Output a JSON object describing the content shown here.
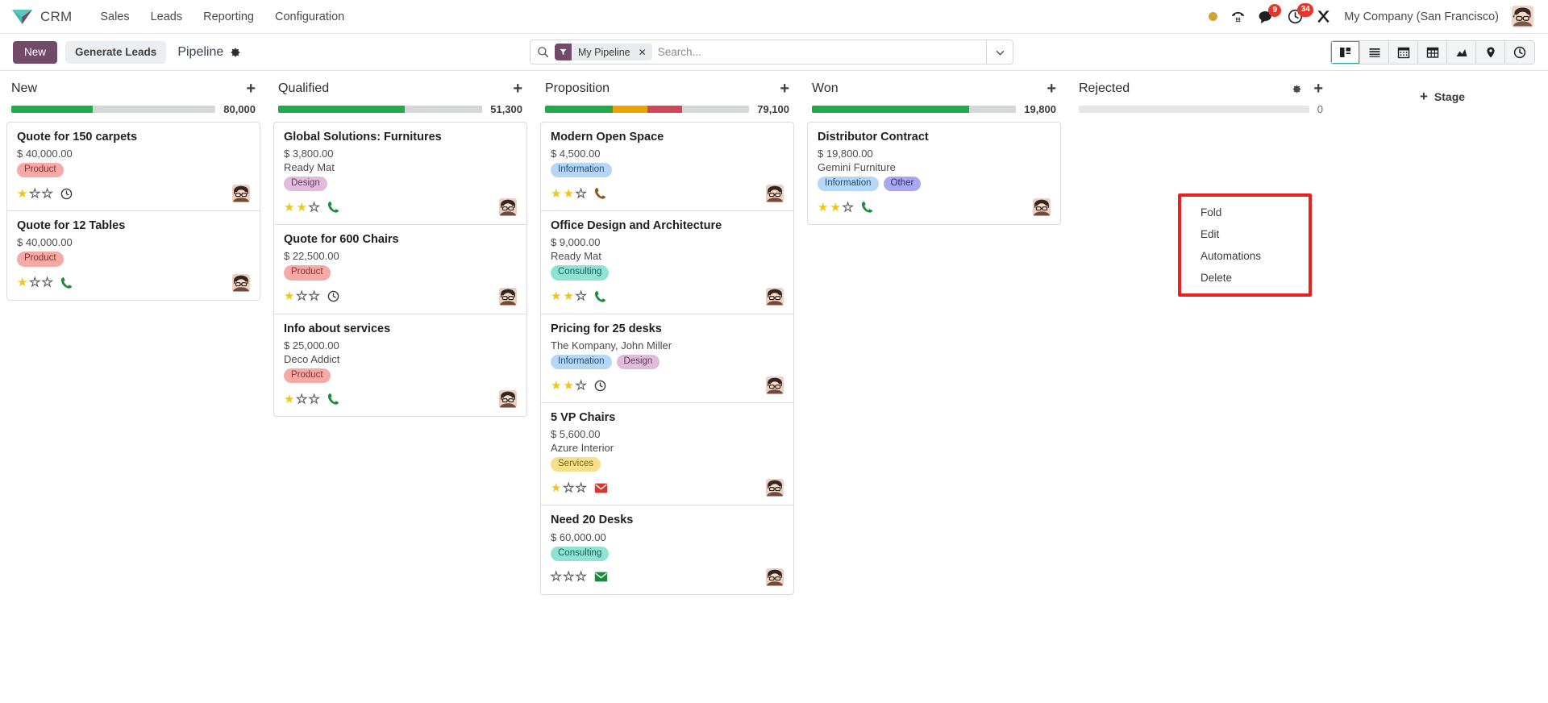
{
  "navbar": {
    "brand": "CRM",
    "menu": [
      "Sales",
      "Leads",
      "Reporting",
      "Configuration"
    ],
    "chat_badge": "9",
    "activity_badge": "34",
    "company": "My Company (San Francisco)"
  },
  "control_panel": {
    "new_label": "New",
    "generate_leads_label": "Generate Leads",
    "breadcrumb": "Pipeline",
    "search": {
      "facet_label": "My Pipeline",
      "placeholder": "Search..."
    },
    "views": [
      "kanban",
      "list",
      "calendar",
      "pivot",
      "graph",
      "map",
      "activity"
    ],
    "active_view": "kanban"
  },
  "add_stage_label": "Stage",
  "column_menu": {
    "items": [
      "Fold",
      "Edit",
      "Automations",
      "Delete"
    ],
    "open_for_column": "Rejected",
    "highlight_color": "#e8231f"
  },
  "tag_colors": {
    "Product": {
      "bg": "#f6aaa7",
      "fg": "#8b2f2b"
    },
    "Design": {
      "bg": "#e0bcdb",
      "fg": "#6d3566"
    },
    "Information": {
      "bg": "#b5d7f5",
      "fg": "#1f4e78"
    },
    "Consulting": {
      "bg": "#8fe3d4",
      "fg": "#155e51"
    },
    "Services": {
      "bg": "#f7e08a",
      "fg": "#7a6212"
    },
    "Other": {
      "bg": "#a9a8ef",
      "fg": "#2f2d7a"
    }
  },
  "columns": [
    {
      "name": "New",
      "total": "80,000",
      "progress": [
        {
          "color": "#23a94a",
          "pct": 40
        },
        {
          "color": "#d5d6d8",
          "pct": 60
        }
      ],
      "has_gear": false,
      "cards": [
        {
          "title": "Quote for 150 carpets",
          "amount": "$ 40,000.00",
          "partner": "",
          "tags": [
            "Product"
          ],
          "stars": 1,
          "activity": "clock-grey"
        },
        {
          "title": "Quote for 12 Tables",
          "amount": "$ 40,000.00",
          "partner": "",
          "tags": [
            "Product"
          ],
          "stars": 1,
          "activity": "phone-green"
        }
      ]
    },
    {
      "name": "Qualified",
      "total": "51,300",
      "progress": [
        {
          "color": "#23a94a",
          "pct": 62
        },
        {
          "color": "#d5d6d8",
          "pct": 38
        }
      ],
      "has_gear": false,
      "cards": [
        {
          "title": "Global Solutions: Furnitures",
          "amount": "$ 3,800.00",
          "partner": "Ready Mat",
          "tags": [
            "Design"
          ],
          "stars": 2,
          "activity": "phone-green"
        },
        {
          "title": "Quote for 600 Chairs",
          "amount": "$ 22,500.00",
          "partner": "",
          "tags": [
            "Product"
          ],
          "stars": 1,
          "activity": "clock-grey"
        },
        {
          "title": "Info about services",
          "amount": "$ 25,000.00",
          "partner": "Deco Addict",
          "tags": [
            "Product"
          ],
          "stars": 1,
          "activity": "phone-green"
        }
      ]
    },
    {
      "name": "Proposition",
      "total": "79,100",
      "progress": [
        {
          "color": "#23a94a",
          "pct": 33
        },
        {
          "color": "#eca200",
          "pct": 17
        },
        {
          "color": "#d1475a",
          "pct": 17
        },
        {
          "color": "#d5d6d8",
          "pct": 33
        }
      ],
      "has_gear": false,
      "cards": [
        {
          "title": "Modern Open Space",
          "amount": "$ 4,500.00",
          "partner": "",
          "tags": [
            "Information"
          ],
          "stars": 2,
          "activity": "phone-brown"
        },
        {
          "title": "Office Design and Architecture",
          "amount": "$ 9,000.00",
          "partner": "Ready Mat",
          "tags": [
            "Consulting"
          ],
          "stars": 2,
          "activity": "phone-green"
        },
        {
          "title": "Pricing for 25 desks",
          "amount": "",
          "partner": "The Kompany, John Miller",
          "tags": [
            "Information",
            "Design"
          ],
          "stars": 2,
          "activity": "clock-grey"
        },
        {
          "title": "5 VP Chairs",
          "amount": "$ 5,600.00",
          "partner": "Azure Interior",
          "tags": [
            "Services"
          ],
          "stars": 1,
          "activity": "mail-red"
        },
        {
          "title": "Need 20 Desks",
          "amount": "$ 60,000.00",
          "partner": "",
          "tags": [
            "Consulting"
          ],
          "stars": 0,
          "activity": "mail-green"
        }
      ]
    },
    {
      "name": "Won",
      "total": "19,800",
      "progress": [
        {
          "color": "#23a94a",
          "pct": 77
        },
        {
          "color": "#d5d6d8",
          "pct": 23
        }
      ],
      "has_gear": false,
      "cards": [
        {
          "title": "Distributor Contract",
          "amount": "$ 19,800.00",
          "partner": "Gemini Furniture",
          "tags": [
            "Information",
            "Other"
          ],
          "stars": 2,
          "activity": "phone-green"
        }
      ]
    },
    {
      "name": "Rejected",
      "total": "0",
      "progress": [
        {
          "color": "#e6e6e6",
          "pct": 100
        }
      ],
      "has_gear": true,
      "cards": []
    }
  ]
}
